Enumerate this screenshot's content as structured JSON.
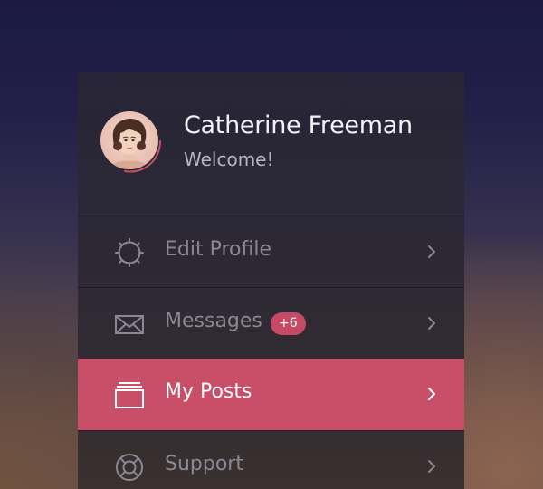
{
  "user": {
    "name": "Catherine Freeman",
    "greeting": "Welcome!"
  },
  "menu": {
    "items": [
      {
        "label": "Edit Profile",
        "icon": "gear-icon",
        "active": false
      },
      {
        "label": "Messages",
        "icon": "envelope-icon",
        "badge": "+6",
        "active": false
      },
      {
        "label": "My Posts",
        "icon": "stack-icon",
        "active": true
      },
      {
        "label": "Support",
        "icon": "lifebuoy-icon",
        "active": false
      }
    ]
  },
  "colors": {
    "accent": "#c94f69",
    "panel": "#2b2835",
    "text_primary": "#f2f2f5",
    "text_muted": "#8b8894"
  }
}
